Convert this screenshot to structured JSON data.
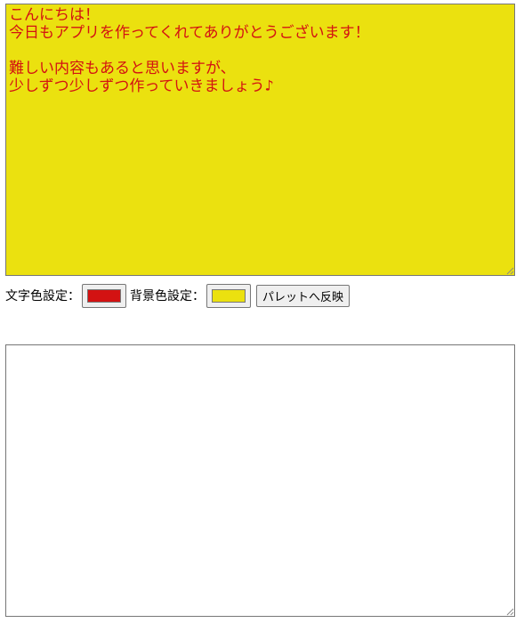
{
  "editor": {
    "text": "こんにちは！\n今日もアプリを作ってくれてありがとうございます！\n\n難しい内容もあると思いますが、\n少しずつ少しずつ作っていきましょう♪",
    "text_color": "#d31212",
    "background_color": "#ebe10f"
  },
  "controls": {
    "text_color_label": "文字色設定：",
    "bg_color_label": "背景色設定：",
    "text_color_value": "#d31212",
    "bg_color_value": "#ebe10f",
    "apply_button_label": "パレットへ反映"
  },
  "palette": {
    "text": ""
  }
}
